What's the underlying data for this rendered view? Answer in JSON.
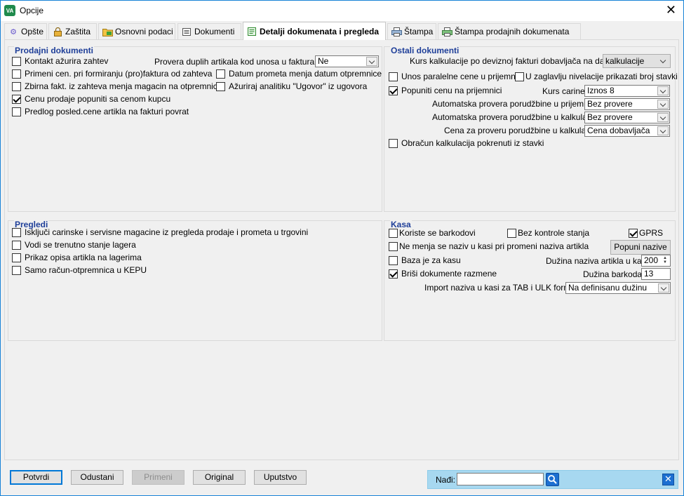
{
  "window": {
    "title": "Opcije",
    "app_icon_text": "VA"
  },
  "tabs": [
    {
      "label": "Opšte"
    },
    {
      "label": "Zaštita"
    },
    {
      "label": "Osnovni podaci"
    },
    {
      "label": "Dokumenti"
    },
    {
      "label": "Detalji dokumenata i pregleda"
    },
    {
      "label": "Štampa"
    },
    {
      "label": "Štampa prodajnih dokumenata"
    }
  ],
  "active_tab": "Detalji dokumenata i pregleda",
  "prodajni": {
    "title": "Prodajni dokumenti",
    "kontakt": {
      "label": "Kontakt ažurira zahtev",
      "checked": false
    },
    "provera_label": "Provera duplih artikala kod unosa u fakturama:",
    "provera_value": "Ne",
    "primeni": {
      "label": "Primeni cen. pri formiranju (pro)faktura od zahteva",
      "checked": false
    },
    "datum": {
      "label": "Datum prometa menja datum otpremnice",
      "checked": false
    },
    "zbirna": {
      "label": "Zbirna fakt. iz zahteva menja magacin na otpremnici",
      "checked": false
    },
    "azuriraj": {
      "label": "Ažuriraj analitiku \"Ugovor\" iz ugovora",
      "checked": false
    },
    "cenu": {
      "label": "Cenu prodaje popuniti sa cenom kupcu",
      "checked": true
    },
    "predlog": {
      "label": "Predlog posled.cene artikla na fakturi povrat",
      "checked": false
    }
  },
  "ostali": {
    "title": "Ostali dokumenti",
    "kurs_label": "Kurs kalkulacije po deviznoj fakturi dobavljača na datum:",
    "kurs_value": "kalkulacije",
    "unos": {
      "label": "Unos paralelne cene u prijemnici",
      "checked": false
    },
    "zaglavlju": {
      "label": "U zaglavlju nivelacije prikazati broj stavki",
      "checked": false
    },
    "popuniti": {
      "label": "Popuniti cenu na prijemnici",
      "checked": true
    },
    "kurs_carine_label": "Kurs carine:",
    "kurs_carine_value": "Iznos 8",
    "auto_prij_label": "Automatska provera porudžbine u prijemnici:",
    "auto_prij_value": "Bez provere",
    "auto_kalk_label": "Automatska provera porudžbine u kalkulaciji:",
    "auto_kalk_value": "Bez provere",
    "cena_label": "Cena za proveru porudžbine u kalkulaciji:",
    "cena_value": "Cena dobavljača",
    "obracun": {
      "label": "Obračun kalkulacija pokrenuti iz stavki",
      "checked": false
    }
  },
  "pregledi": {
    "title": "Pregledi",
    "iskljuci": {
      "label": "Isključi carinske i servisne magacine iz pregleda prodaje i prometa u trgovini",
      "checked": false
    },
    "vodi": {
      "label": "Vodi se trenutno stanje lagera",
      "checked": false
    },
    "prikaz": {
      "label": "Prikaz opisa artikla na lagerima",
      "checked": false
    },
    "samo": {
      "label": "Samo račun-otpremnica u KEPU",
      "checked": false
    }
  },
  "kasa": {
    "title": "Kasa",
    "koriste": {
      "label": "Koriste se barkodovi",
      "checked": false
    },
    "bez_kontrole": {
      "label": "Bez kontrole stanja",
      "checked": false
    },
    "gprs": {
      "label": "GPRS",
      "checked": true
    },
    "ne_menja": {
      "label": "Ne menja se naziv u kasi pri promeni naziva artikla",
      "checked": false
    },
    "popuni_btn": "Popuni nazive",
    "baza": {
      "label": "Baza je za kasu",
      "checked": false
    },
    "duzina_naziva_label": "Dužina naziva artikla u kasi:",
    "duzina_naziva_value": "200",
    "brisi": {
      "label": "Briši dokumente razmene",
      "checked": true
    },
    "duzina_barkoda_label": "Dužina barkoda:",
    "duzina_barkoda_value": "13",
    "import_label": "Import naziva u kasi za TAB i ULK format:",
    "import_value": "Na definisanu dužinu"
  },
  "footer": {
    "potvrdi": "Potvrdi",
    "odustani": "Odustani",
    "primeni": "Primeni",
    "original": "Original",
    "uputstvo": "Uputstvo",
    "nadji_label": "Nađi:",
    "nadji_value": ""
  }
}
